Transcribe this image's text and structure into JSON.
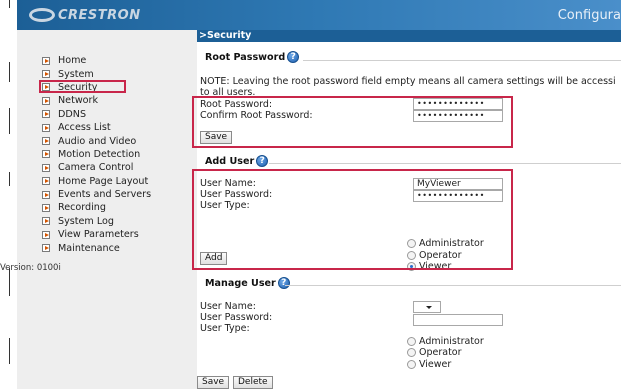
{
  "header": {
    "logo_text": "CRESTRON",
    "title": "Configura"
  },
  "sidebar": {
    "items": [
      {
        "label": "Home"
      },
      {
        "label": "System"
      },
      {
        "label": "Security"
      },
      {
        "label": "Network"
      },
      {
        "label": "DDNS"
      },
      {
        "label": "Access List"
      },
      {
        "label": "Audio and Video"
      },
      {
        "label": "Motion Detection"
      },
      {
        "label": "Camera Control"
      },
      {
        "label": "Home Page Layout"
      },
      {
        "label": "Events and Servers"
      },
      {
        "label": "Recording"
      },
      {
        "label": "System Log"
      },
      {
        "label": "View Parameters"
      },
      {
        "label": "Maintenance"
      }
    ],
    "version": "Version: 0100i"
  },
  "main": {
    "breadcrumb": ">Security",
    "root_password": {
      "title": "Root Password",
      "note": "NOTE: Leaving the root password field empty means all camera settings will be accessi to all users.",
      "root_password_label": "Root Password:",
      "confirm_label": "Confirm Root Password:",
      "root_password_value": "•••••••••••••",
      "confirm_value": "•••••••••••••",
      "save_label": "Save"
    },
    "add_user": {
      "title": "Add User",
      "user_name_label": "User Name:",
      "user_password_label": "User Password:",
      "user_type_label": "User Type:",
      "user_name_value": "MyViewer",
      "user_password_value": "•••••••••••••",
      "types": [
        "Administrator",
        "Operator",
        "Viewer"
      ],
      "selected": "Viewer",
      "add_label": "Add"
    },
    "manage_user": {
      "title": "Manage User",
      "user_name_label": "User Name:",
      "user_password_label": "User Password:",
      "user_type_label": "User Type:",
      "types": [
        "Administrator",
        "Operator",
        "Viewer"
      ],
      "save_label": "Save",
      "delete_label": "Delete"
    }
  }
}
